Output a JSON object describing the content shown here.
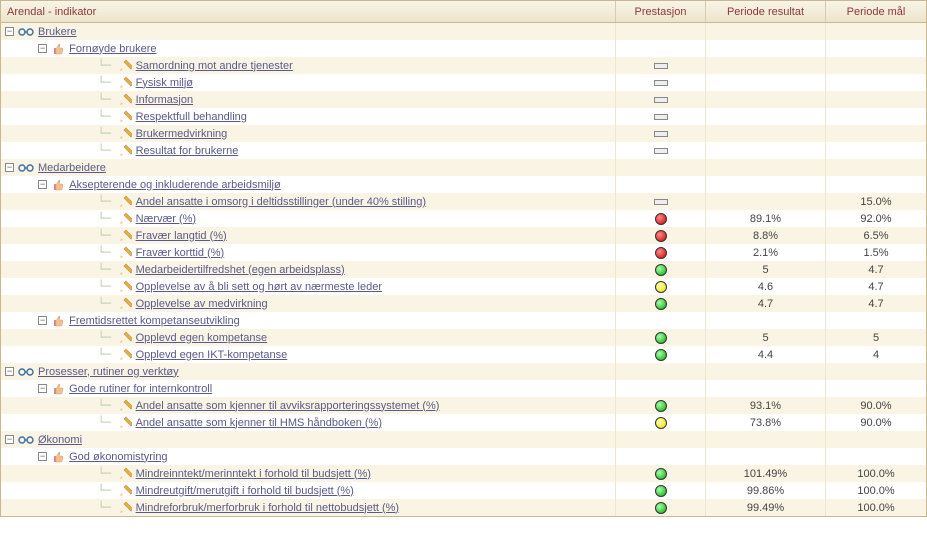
{
  "header": {
    "indicator": "Arendal - indikator",
    "prestasjon": "Prestasjon",
    "periode_resultat": "Periode resultat",
    "periode_mal": "Periode mål"
  },
  "rows": [
    {
      "depth": 0,
      "expander": "-",
      "icon": "glasses",
      "label": "Brukere",
      "perf": "",
      "result": "",
      "goal": ""
    },
    {
      "depth": 1,
      "expander": "-",
      "icon": "thumb",
      "label": "Fornøyde brukere",
      "perf": "",
      "result": "",
      "goal": ""
    },
    {
      "depth": 2,
      "expander": "",
      "icon": "pencil",
      "label": "Samordning mot andre tjenester",
      "perf": "box",
      "result": "",
      "goal": ""
    },
    {
      "depth": 2,
      "expander": "",
      "icon": "pencil",
      "label": "Fysisk miljø",
      "perf": "box",
      "result": "",
      "goal": ""
    },
    {
      "depth": 2,
      "expander": "",
      "icon": "pencil",
      "label": "Informasjon",
      "perf": "box",
      "result": "",
      "goal": ""
    },
    {
      "depth": 2,
      "expander": "",
      "icon": "pencil",
      "label": "Respektfull behandling",
      "perf": "box",
      "result": "",
      "goal": ""
    },
    {
      "depth": 2,
      "expander": "",
      "icon": "pencil",
      "label": "Brukermedvirkning",
      "perf": "box",
      "result": "",
      "goal": ""
    },
    {
      "depth": 2,
      "expander": "",
      "icon": "pencil",
      "label": "Resultat for brukerne",
      "perf": "box",
      "result": "",
      "goal": ""
    },
    {
      "depth": 0,
      "expander": "-",
      "icon": "glasses",
      "label": "Medarbeidere",
      "perf": "",
      "result": "",
      "goal": ""
    },
    {
      "depth": 1,
      "expander": "-",
      "icon": "thumb",
      "label": "Aksepterende og inkluderende arbeidsmiljø",
      "perf": "",
      "result": "",
      "goal": ""
    },
    {
      "depth": 2,
      "expander": "",
      "icon": "pencil",
      "label": "Andel ansatte i omsorg i deltidsstillinger (under 40% stilling)",
      "perf": "box",
      "result": "",
      "goal": "15.0%"
    },
    {
      "depth": 2,
      "expander": "",
      "icon": "pencil",
      "label": "Nærvær (%)",
      "perf": "red",
      "result": "89.1%",
      "goal": "92.0%"
    },
    {
      "depth": 2,
      "expander": "",
      "icon": "pencil",
      "label": "Fravær langtid (%)",
      "perf": "red",
      "result": "8.8%",
      "goal": "6.5%"
    },
    {
      "depth": 2,
      "expander": "",
      "icon": "pencil",
      "label": "Fravær korttid (%)",
      "perf": "red",
      "result": "2.1%",
      "goal": "1.5%"
    },
    {
      "depth": 2,
      "expander": "",
      "icon": "pencil",
      "label": "Medarbeidertilfredshet (egen arbeidsplass)",
      "perf": "green",
      "result": "5",
      "goal": "4.7"
    },
    {
      "depth": 2,
      "expander": "",
      "icon": "pencil",
      "label": "Opplevelse av å bli sett og hørt av nærmeste leder",
      "perf": "yellow",
      "result": "4.6",
      "goal": "4.7"
    },
    {
      "depth": 2,
      "expander": "",
      "icon": "pencil",
      "label": "Opplevelse av medvirkning",
      "perf": "green",
      "result": "4.7",
      "goal": "4.7"
    },
    {
      "depth": 1,
      "expander": "-",
      "icon": "thumb",
      "label": "Fremtidsrettet kompetanseutvikling",
      "perf": "",
      "result": "",
      "goal": ""
    },
    {
      "depth": 2,
      "expander": "",
      "icon": "pencil",
      "label": "Opplevd egen kompetanse",
      "perf": "green",
      "result": "5",
      "goal": "5"
    },
    {
      "depth": 2,
      "expander": "",
      "icon": "pencil",
      "label": "Opplevd egen IKT-kompetanse",
      "perf": "green",
      "result": "4.4",
      "goal": "4"
    },
    {
      "depth": 0,
      "expander": "-",
      "icon": "glasses",
      "label": "Prosesser, rutiner og verktøy",
      "perf": "",
      "result": "",
      "goal": ""
    },
    {
      "depth": 1,
      "expander": "-",
      "icon": "thumb",
      "label": "Gode rutiner for internkontroll",
      "perf": "",
      "result": "",
      "goal": ""
    },
    {
      "depth": 2,
      "expander": "",
      "icon": "pencil",
      "label": "Andel ansatte som kjenner til avviksrapporteringssystemet (%)",
      "perf": "green",
      "result": "93.1%",
      "goal": "90.0%"
    },
    {
      "depth": 2,
      "expander": "",
      "icon": "pencil",
      "label": "Andel ansatte som kjenner til HMS håndboken (%)",
      "perf": "yellow",
      "result": "73.8%",
      "goal": "90.0%"
    },
    {
      "depth": 0,
      "expander": "-",
      "icon": "glasses",
      "label": "Økonomi",
      "perf": "",
      "result": "",
      "goal": ""
    },
    {
      "depth": 1,
      "expander": "-",
      "icon": "thumb",
      "label": "God økonomistyring",
      "perf": "",
      "result": "",
      "goal": ""
    },
    {
      "depth": 2,
      "expander": "",
      "icon": "pencil",
      "label": "Mindreinntekt/merinntekt i forhold til budsjett (%)",
      "perf": "green",
      "result": "101.49%",
      "goal": "100.0%"
    },
    {
      "depth": 2,
      "expander": "",
      "icon": "pencil",
      "label": "Mindreutgift/merutgift i forhold til budsjett (%)",
      "perf": "green",
      "result": "99.86%",
      "goal": "100.0%"
    },
    {
      "depth": 2,
      "expander": "",
      "icon": "pencil",
      "label": "Mindreforbruk/merforbruk i forhold til nettobudsjett (%)",
      "perf": "green",
      "result": "99.49%",
      "goal": "100.0%"
    }
  ]
}
